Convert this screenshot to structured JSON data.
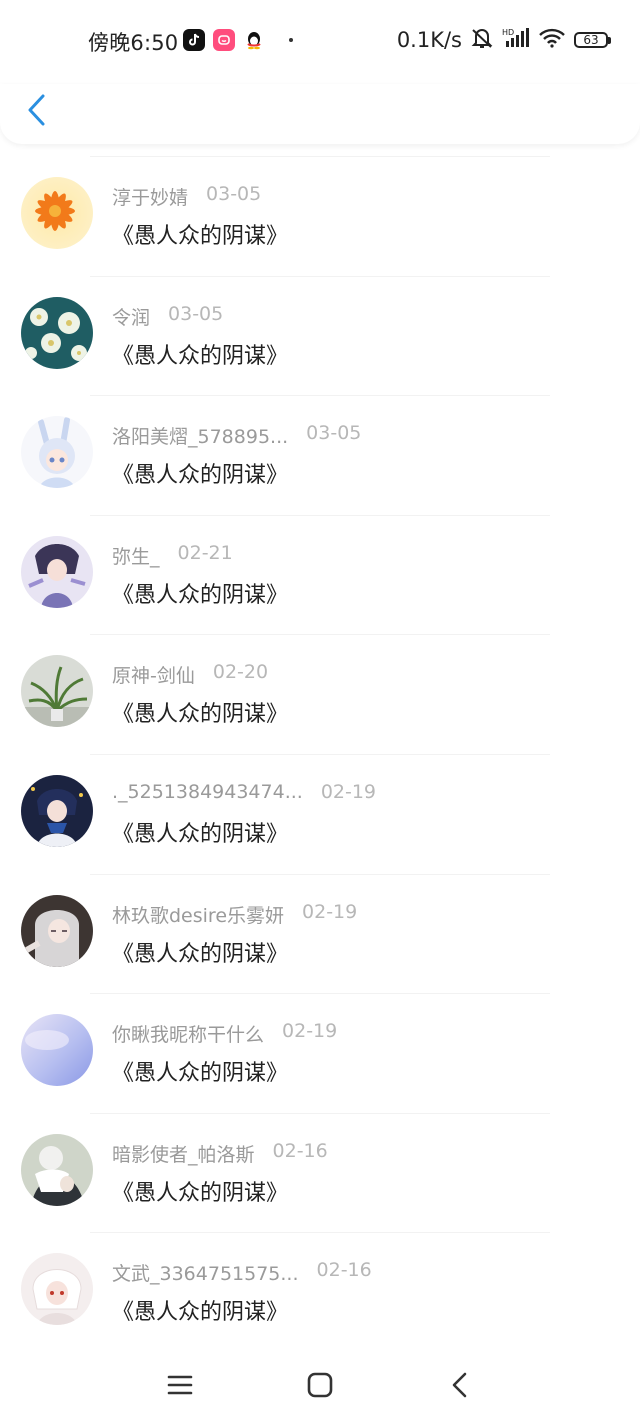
{
  "statusbar": {
    "time": "傍晚6:50",
    "speed": "0.1K/s",
    "battery": "63"
  },
  "colors": {
    "accent": "#2a8fe0",
    "text": "#222222",
    "muted": "#9a9a9a"
  },
  "header": {
    "back_icon": "chevron-left-icon"
  },
  "items": [
    {
      "name": "淳于妙婧",
      "date": "03-05",
      "title": "《愚人众的阴谋》",
      "avatar": "orange-flower-avatar"
    },
    {
      "name": "令润",
      "date": "03-05",
      "title": "《愚人众的阴谋》",
      "avatar": "white-flowers-avatar"
    },
    {
      "name": "洛阳美熠_578895...",
      "date": "03-05",
      "title": "《愚人众的阴谋》",
      "avatar": "anime-girl-bunny-avatar"
    },
    {
      "name": "弥生_",
      "date": "02-21",
      "title": "《愚人众的阴谋》",
      "avatar": "anime-character-avatar"
    },
    {
      "name": "原神-剑仙",
      "date": "02-20",
      "title": "《愚人众的阴谋》",
      "avatar": "potted-plant-avatar"
    },
    {
      "name": "._5251384943474...",
      "date": "02-19",
      "title": "《愚人众的阴谋》",
      "avatar": "anime-boy-avatar"
    },
    {
      "name": "林玖歌desire乐雾妍",
      "date": "02-19",
      "title": "《愚人众的阴谋》",
      "avatar": "anime-silver-hair-avatar"
    },
    {
      "name": "你瞅我昵称干什么",
      "date": "02-19",
      "title": "《愚人众的阴谋》",
      "avatar": "sky-gradient-avatar"
    },
    {
      "name": "暗影使者_帕洛斯",
      "date": "02-16",
      "title": "《愚人众的阴谋》",
      "avatar": "anime-dual-figure-avatar"
    },
    {
      "name": "文武_3364751575...",
      "date": "02-16",
      "title": "《愚人众的阴谋》",
      "avatar": "anime-white-hair-avatar"
    }
  ],
  "navbar": {
    "menu_icon": "menu-icon",
    "home_icon": "home-icon",
    "back_icon": "back-icon"
  }
}
